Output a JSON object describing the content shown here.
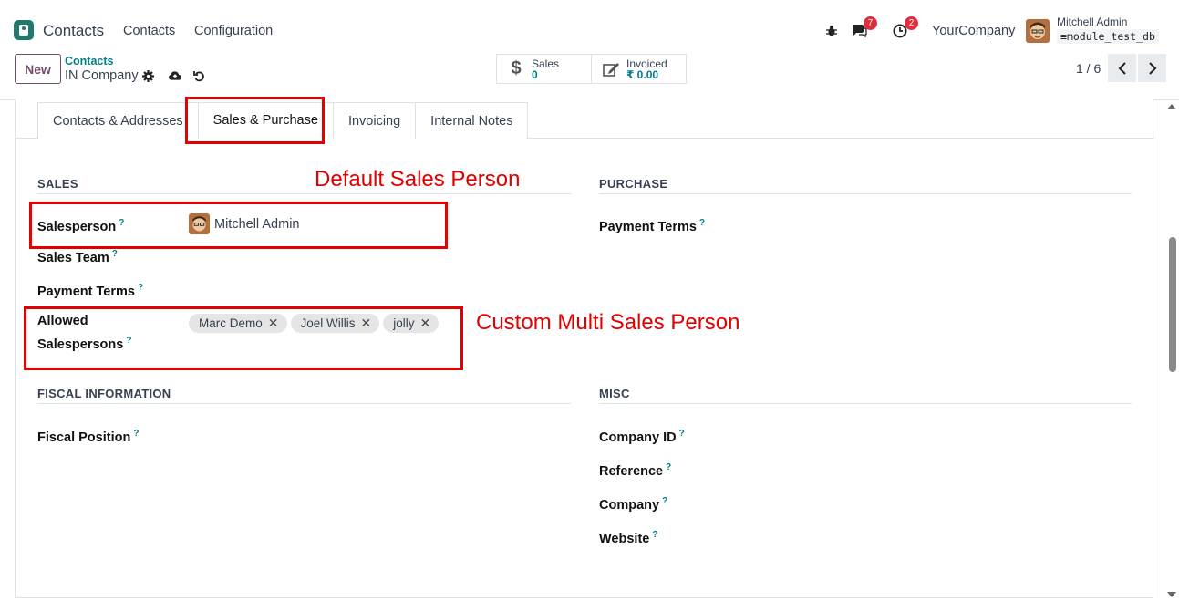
{
  "navbar": {
    "app_name": "Contacts",
    "menu": [
      "Contacts",
      "Configuration"
    ],
    "messages_count": "7",
    "activities_count": "2",
    "company": "YourCompany",
    "user_name": "Mitchell Admin",
    "db_name": "module_test_db"
  },
  "control": {
    "new_label": "New",
    "breadcrumb": "Contacts",
    "record_name": "IN Company",
    "stats": [
      {
        "label": "Sales",
        "value": "0",
        "icon": "dollar-icon"
      },
      {
        "label": "Invoiced",
        "value": "₹ 0.00",
        "icon": "pencil-square-icon"
      }
    ],
    "pager": "1 / 6"
  },
  "tabs": [
    "Contacts & Addresses",
    "Sales & Purchase",
    "Invoicing",
    "Internal Notes"
  ],
  "active_tab": "Sales & Purchase",
  "sales": {
    "title": "SALES",
    "salesperson_label": "Salesperson",
    "salesperson_value": "Mitchell Admin",
    "sales_team_label": "Sales Team",
    "payment_terms_label": "Payment Terms",
    "allowed_label_1": "Allowed",
    "allowed_label_2": "Salespersons",
    "allowed_tags": [
      "Marc Demo",
      "Joel Willis",
      "jolly"
    ]
  },
  "purchase": {
    "title": "PURCHASE",
    "payment_terms_label": "Payment Terms"
  },
  "fiscal": {
    "title": "FISCAL INFORMATION",
    "fiscal_position_label": "Fiscal Position"
  },
  "misc": {
    "title": "MISC",
    "company_id_label": "Company ID",
    "reference_label": "Reference",
    "company_label": "Company",
    "website_label": "Website"
  },
  "annotations": {
    "default_sales_person": "Default Sales Person",
    "custom_multi_sales_person": "Custom Multi Sales Person",
    "color": "#e20000"
  },
  "help_mark": "?"
}
